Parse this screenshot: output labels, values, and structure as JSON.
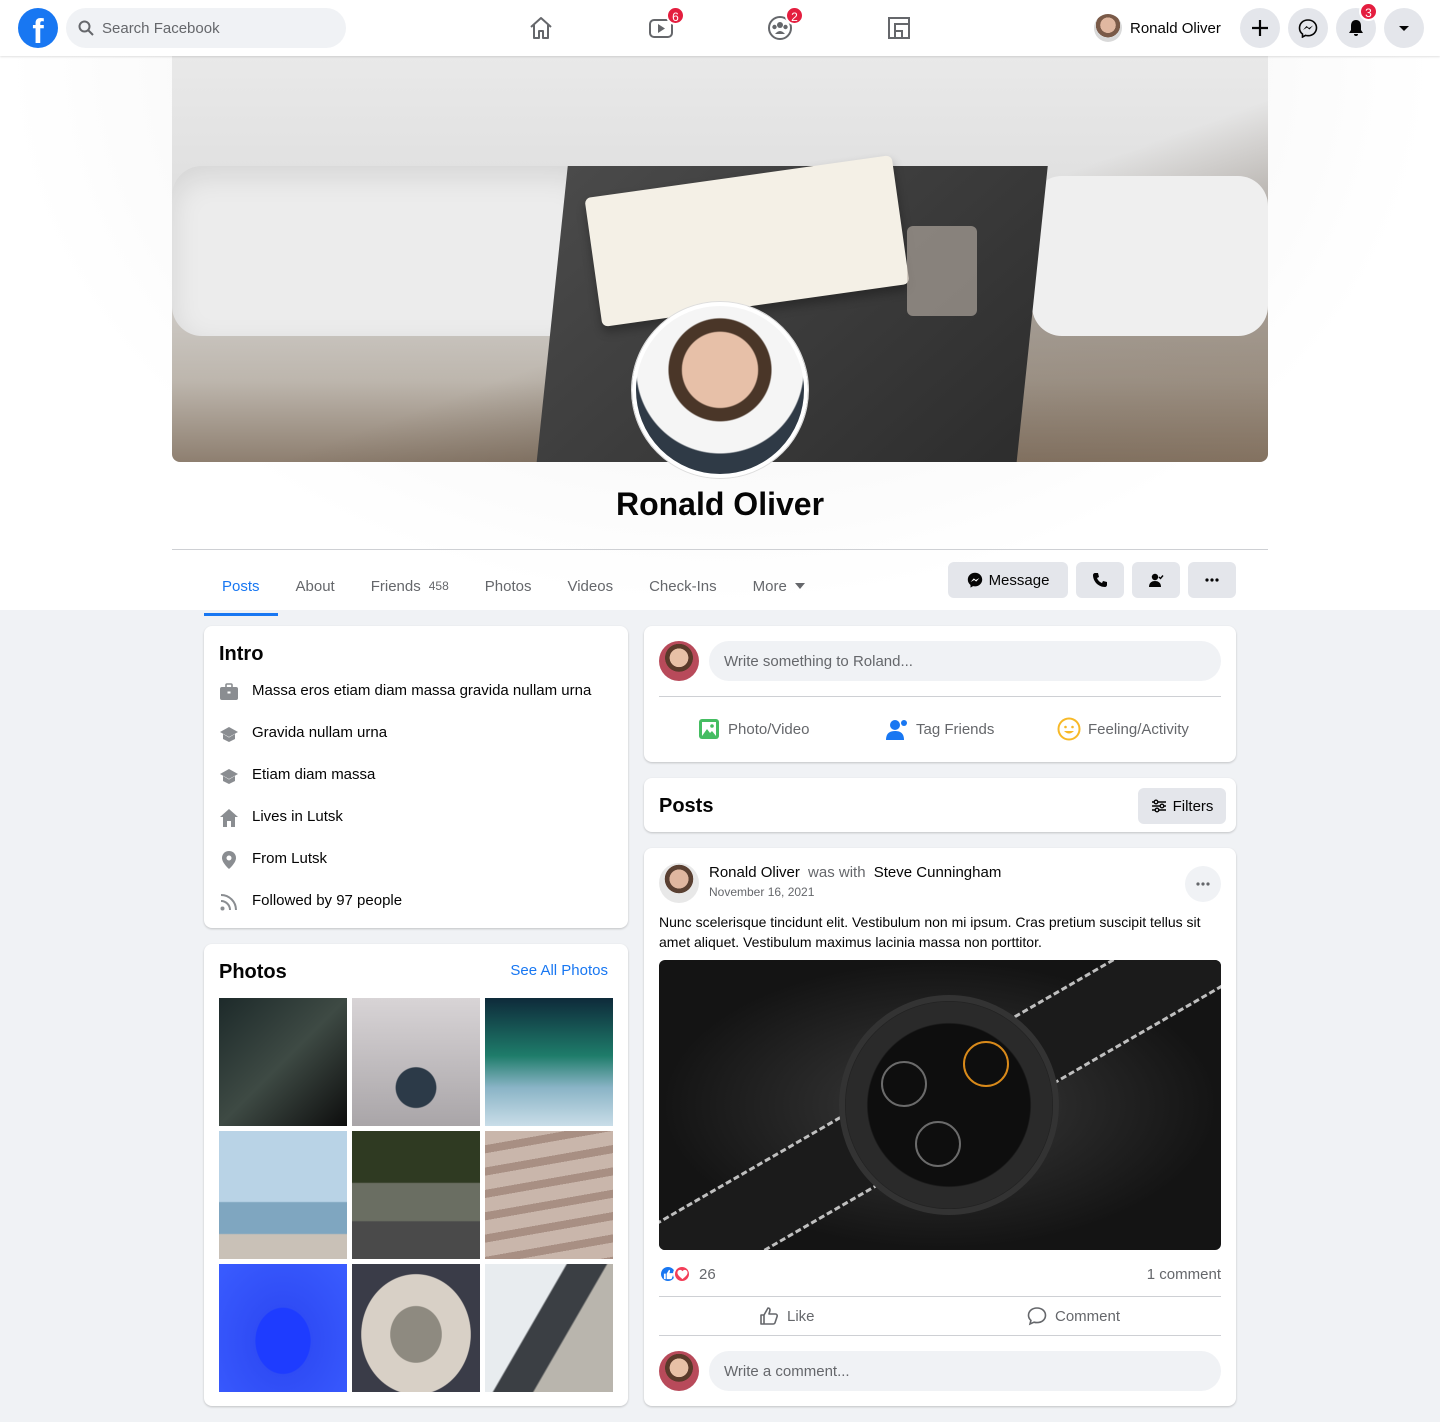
{
  "topnav": {
    "logo": "f",
    "search_placeholder": "Search Facebook",
    "badges": {
      "watch": "6",
      "groups": "2",
      "notifications": "3"
    },
    "user_name": "Ronald Oliver",
    "icons": [
      "home-icon",
      "watch-icon",
      "groups-icon",
      "gaming-icon",
      "plus-icon",
      "messenger-icon",
      "bell-icon",
      "caret-down-icon"
    ]
  },
  "profile": {
    "name": "Ronald Oliver"
  },
  "tabs": [
    {
      "label": "Posts",
      "active": true
    },
    {
      "label": "About"
    },
    {
      "label": "Friends",
      "count": "458"
    },
    {
      "label": "Photos"
    },
    {
      "label": "Videos"
    },
    {
      "label": "Check-Ins"
    },
    {
      "label": "More"
    }
  ],
  "header_actions": {
    "message_label": "Message"
  },
  "intro": {
    "title": "Intro",
    "items": [
      {
        "icon": "briefcase-icon",
        "text": "Massa eros etiam diam massa gravida nullam urna"
      },
      {
        "icon": "graduation-cap-icon",
        "text": "Gravida nullam urna"
      },
      {
        "icon": "graduation-cap-icon",
        "text": "Etiam diam massa"
      },
      {
        "icon": "house-icon",
        "text": "Lives in Lutsk"
      },
      {
        "icon": "location-pin-icon",
        "text": "From Lutsk"
      },
      {
        "icon": "rss-icon",
        "text": "Followed by 97 people"
      }
    ]
  },
  "photos": {
    "title": "Photos",
    "see_all": "See All Photos"
  },
  "composer": {
    "placeholder": "Write something to Roland...",
    "actions": {
      "photo": "Photo/Video",
      "tag": "Tag Friends",
      "feeling": "Feeling/Activity"
    }
  },
  "posts_header": {
    "title": "Posts",
    "filters_label": "Filters"
  },
  "post": {
    "author": "Ronald Oliver",
    "with_text": "was with",
    "with_name": "Steve Cunningham",
    "date": "November 16, 2021",
    "text": "Nunc scelerisque tincidunt elit. Vestibulum non mi ipsum. Cras pretium suscipit tellus sit amet aliquet. Vestibulum maximus lacinia massa non porttitor.",
    "reaction_count": "26",
    "comment_count": "1 comment",
    "like_label": "Like",
    "comment_label": "Comment",
    "comment_placeholder": "Write a comment..."
  },
  "colors": {
    "accent": "#1877f2",
    "badge": "#e41e3f",
    "background": "#f0f2f5"
  }
}
